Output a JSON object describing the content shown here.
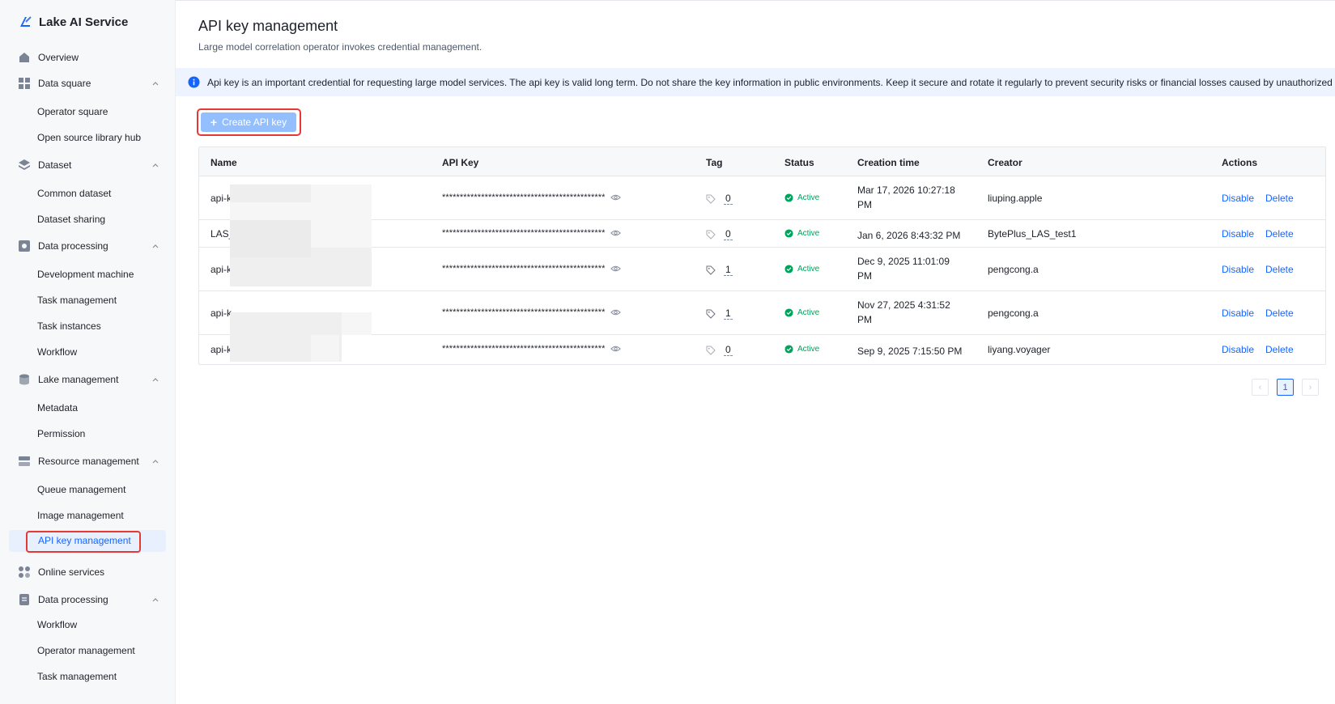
{
  "app": {
    "title": "Lake AI Service"
  },
  "sidebar": {
    "overview": "Overview",
    "data_square": {
      "label": "Data square",
      "items": [
        "Operator square",
        "Open source library hub"
      ]
    },
    "dataset": {
      "label": "Dataset",
      "items": [
        "Common dataset",
        "Dataset sharing"
      ]
    },
    "data_processing": {
      "label": "Data processing",
      "items": [
        "Development machine",
        "Task management",
        "Task instances",
        "Workflow"
      ]
    },
    "lake_management": {
      "label": "Lake management",
      "items": [
        "Metadata",
        "Permission"
      ]
    },
    "resource_management": {
      "label": "Resource management",
      "items": [
        "Queue management",
        "Image management",
        "API key management"
      ]
    },
    "online_services": "Online services",
    "data_processing_2": {
      "label": "Data processing",
      "items": [
        "Workflow",
        "Operator management",
        "Task management"
      ]
    }
  },
  "page": {
    "title": "API key management",
    "subtitle": "Large model correlation operator invokes credential management.",
    "alert": "Api key is an important credential for requesting large model services. The api key is valid long term. Do not share the key information in public environments. Keep it secure and rotate it regularly to prevent security risks or financial losses caused by unauthorized use",
    "create_button": "Create API key"
  },
  "table": {
    "headers": {
      "name": "Name",
      "api_key": "API Key",
      "tag": "Tag",
      "status": "Status",
      "creation_time": "Creation time",
      "creator": "Creator",
      "actions": "Actions"
    },
    "rows": [
      {
        "name": "api-k",
        "api_key": "**********************************************",
        "tag": "0",
        "status": "Active",
        "time": "Mar 17, 2026 10:27:18 PM",
        "creator": "liuping.apple",
        "disable": "Disable",
        "delete": "Delete"
      },
      {
        "name": "LAS_",
        "api_key": "**********************************************",
        "tag": "0",
        "status": "Active",
        "time": "Jan 6, 2026 8:43:32 PM",
        "creator": "BytePlus_LAS_test1",
        "disable": "Disable",
        "delete": "Delete"
      },
      {
        "name": "api-k",
        "api_key": "**********************************************",
        "tag": "1",
        "status": "Active",
        "time": "Dec 9, 2025 11:01:09 PM",
        "creator": "pengcong.a",
        "disable": "Disable",
        "delete": "Delete"
      },
      {
        "name": "api-k",
        "api_key": "**********************************************",
        "tag": "1",
        "status": "Active",
        "time": "Nov 27, 2025 4:31:52 PM",
        "creator": "pengcong.a",
        "disable": "Disable",
        "delete": "Delete"
      },
      {
        "name": "api-k",
        "api_key": "**********************************************",
        "tag": "0",
        "status": "Active",
        "time": "Sep 9, 2025 7:15:50 PM",
        "creator": "liyang.voyager",
        "disable": "Disable",
        "delete": "Delete"
      }
    ]
  },
  "pagination": {
    "current": "1",
    "prev": "‹",
    "next": "›"
  },
  "colors": {
    "accent": "#1664ff",
    "success": "#00a35c",
    "highlight": "#e53935",
    "button_disabled": "#94bfff"
  }
}
